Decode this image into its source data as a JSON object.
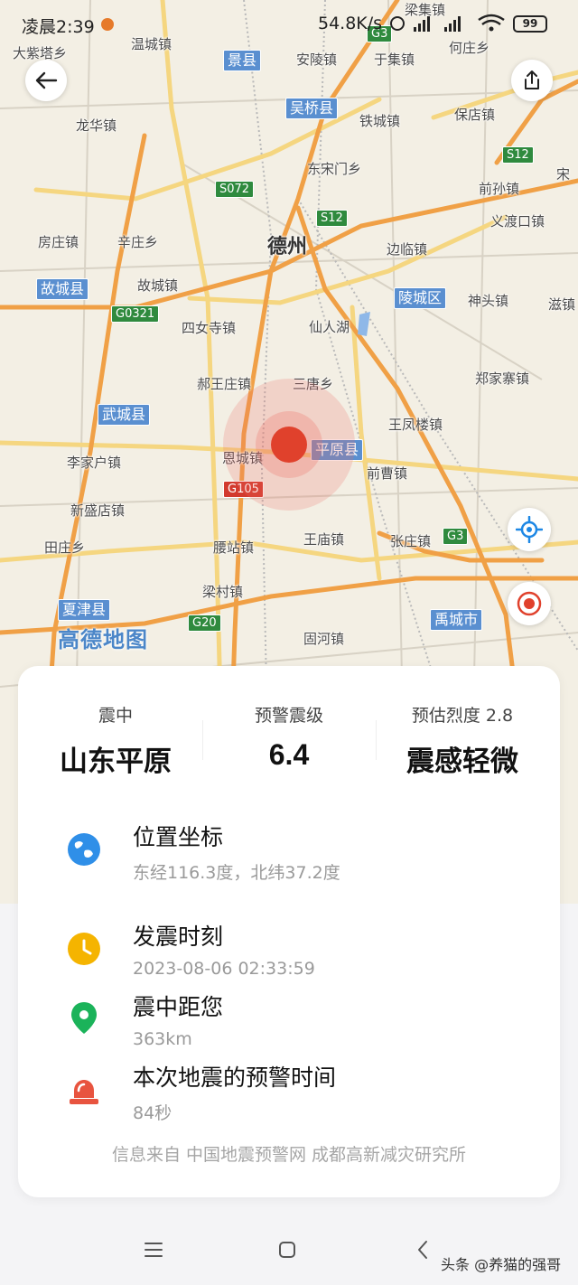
{
  "status_bar": {
    "time": "凌晨2:39",
    "net_speed": "54.8K/s",
    "battery": "99"
  },
  "map": {
    "watermark": "高德地图",
    "city": "德州",
    "places": [
      "大紫塔乡",
      "温城镇",
      "安陵镇",
      "于集镇",
      "何庄乡",
      "龙华镇",
      "铁城镇",
      "保店镇",
      "东宋门乡",
      "前孙镇",
      "义渡口镇",
      "房庄镇",
      "辛庄乡",
      "边临镇",
      "故城镇",
      "神头镇",
      "滋镇",
      "四女寺镇",
      "仙人湖",
      "郑家寨镇",
      "郝王庄镇",
      "三唐乡",
      "王凤楼镇",
      "恩城镇",
      "前曹镇",
      "李家户镇",
      "新盛店镇",
      "王庙镇",
      "张庄镇",
      "田庄乡",
      "腰站镇",
      "梁村镇",
      "固河镇",
      "梁集镇",
      "宋"
    ],
    "counties": [
      "景县",
      "吴桥县",
      "故城县",
      "陵城区",
      "武城县",
      "平原县",
      "夏津县",
      "禹城市"
    ],
    "shields": [
      "G3",
      "S12",
      "S072",
      "S12",
      "G0321",
      "G105",
      "G3",
      "G20"
    ]
  },
  "summary": {
    "epicenter_label": "震中",
    "epicenter_value": "山东平原",
    "magnitude_label": "预警震级",
    "magnitude_value": "6.4",
    "intensity_label": "预估烈度 2.8",
    "intensity_value": "震感轻微"
  },
  "details": [
    {
      "icon": "globe-icon",
      "title": "位置坐标",
      "sub": "东经116.3度，北纬37.2度",
      "color": "#2f8fe8"
    },
    {
      "icon": "clock-icon",
      "title": "发震时刻",
      "sub": "2023-08-06 02:33:59",
      "color": "#f5b400"
    },
    {
      "icon": "location-pin-icon",
      "title": "震中距您",
      "sub": "363km",
      "color": "#1bb35a"
    },
    {
      "icon": "siren-icon",
      "title": "本次地震的预警时间",
      "sub": "84秒",
      "color": "#e8543f"
    }
  ],
  "source": "信息来自 中国地震预警网 成都高新减灾研究所",
  "footer": {
    "watermark": "头条 @养猫的强哥"
  },
  "colors": {
    "epicenter": "#e0412c",
    "locate_icon": "#1e88e5",
    "map_bg": "#f3efe4"
  }
}
